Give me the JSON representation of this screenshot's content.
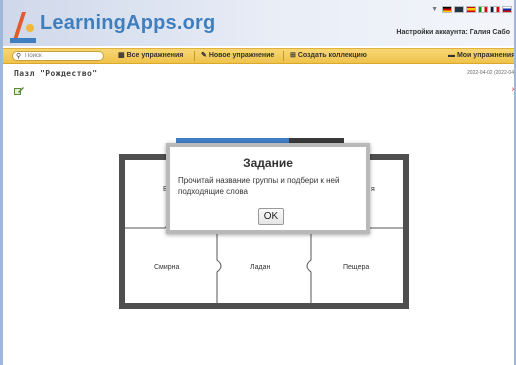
{
  "header": {
    "logo_text": "LearningApps.org",
    "account_link": "Настройки аккаунта: Галия Сабо",
    "flags": [
      "de",
      "gb",
      "es",
      "it",
      "fr",
      "ru"
    ]
  },
  "toolbar": {
    "search_placeholder": "Поиск",
    "all_exercises": "Все упражнения",
    "new_exercise": "Новое упражнение",
    "create_collection": "Создать коллекцию",
    "my_exercises": "Мои упражнения"
  },
  "app": {
    "title": "Пазл \"Рождество\"",
    "date": "2022-04-02 (2022-04"
  },
  "puzzle": {
    "pieces": [
      {
        "label": "В",
        "row": 0,
        "col": 0
      },
      {
        "label": "я",
        "row": 0,
        "col": 2
      },
      {
        "label": "Смирна",
        "row": 1,
        "col": 0
      },
      {
        "label": "Ладан",
        "row": 1,
        "col": 1
      },
      {
        "label": "Пещера",
        "row": 1,
        "col": 2
      }
    ]
  },
  "dialog": {
    "title": "Задание",
    "body": "Прочитай название группы и подбери к ней подходящие слова",
    "ok_label": "OK"
  },
  "colors": {
    "toolbar": "#efc24a",
    "logo": "#3f7fbf",
    "board_frame": "#4f4f4f",
    "tab_blue": "#3f7ec7"
  }
}
